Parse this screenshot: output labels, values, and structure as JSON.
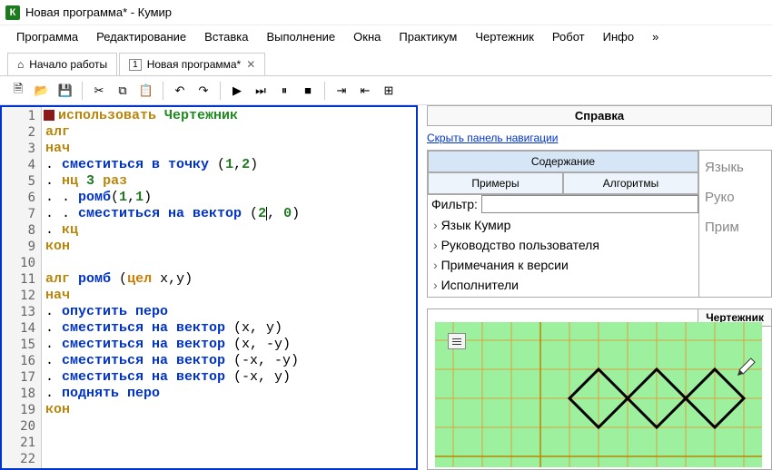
{
  "window": {
    "title": "Новая программа* - Кумир",
    "icon_letter": "К"
  },
  "menubar": [
    "Программа",
    "Редактирование",
    "Вставка",
    "Выполнение",
    "Окна",
    "Практикум",
    "Чертежник",
    "Робот",
    "Инфо",
    "»"
  ],
  "tabs": [
    {
      "label": "Начало работы",
      "closable": false
    },
    {
      "label": "Новая программа*",
      "closable": true,
      "num": "1"
    }
  ],
  "toolbar_icons": [
    "new",
    "open",
    "save",
    "cut",
    "copy",
    "paste",
    "undo",
    "redo",
    "run",
    "step",
    "pause",
    "stop",
    "indent",
    "outdent",
    "ruler"
  ],
  "code": {
    "lines": [
      [
        {
          "t": "marker"
        },
        {
          "t": "kw",
          "v": "использовать "
        },
        {
          "t": "actor",
          "v": "Чертежник"
        }
      ],
      [
        {
          "t": "kw",
          "v": "алг"
        }
      ],
      [
        {
          "t": "kw",
          "v": "нач"
        }
      ],
      [
        {
          "t": "plain",
          "v": ". "
        },
        {
          "t": "cmd",
          "v": "сместиться в точку"
        },
        {
          "t": "plain",
          "v": " ("
        },
        {
          "t": "num",
          "v": "1"
        },
        {
          "t": "plain",
          "v": ","
        },
        {
          "t": "num",
          "v": "2"
        },
        {
          "t": "plain",
          "v": ")"
        }
      ],
      [
        {
          "t": "plain",
          "v": ". "
        },
        {
          "t": "kw",
          "v": "нц"
        },
        {
          "t": "plain",
          "v": " "
        },
        {
          "t": "num",
          "v": "3"
        },
        {
          "t": "plain",
          "v": " "
        },
        {
          "t": "kw",
          "v": "раз"
        }
      ],
      [
        {
          "t": "plain",
          "v": ". . "
        },
        {
          "t": "cmd",
          "v": "ромб"
        },
        {
          "t": "plain",
          "v": "("
        },
        {
          "t": "num",
          "v": "1"
        },
        {
          "t": "plain",
          "v": ","
        },
        {
          "t": "num",
          "v": "1"
        },
        {
          "t": "plain",
          "v": ")"
        }
      ],
      [
        {
          "t": "plain",
          "v": ". . "
        },
        {
          "t": "cmd",
          "v": "сместиться на вектор"
        },
        {
          "t": "plain",
          "v": " ("
        },
        {
          "t": "num",
          "v": "2"
        },
        {
          "t": "caret"
        },
        {
          "t": "plain",
          "v": ", "
        },
        {
          "t": "num",
          "v": "0"
        },
        {
          "t": "plain",
          "v": ")"
        }
      ],
      [
        {
          "t": "plain",
          "v": ". "
        },
        {
          "t": "kw",
          "v": "кц"
        }
      ],
      [
        {
          "t": "kw",
          "v": "кон"
        }
      ],
      [],
      [
        {
          "t": "kw",
          "v": "алг"
        },
        {
          "t": "plain",
          "v": " "
        },
        {
          "t": "cmd",
          "v": "ромб"
        },
        {
          "t": "plain",
          "v": " ("
        },
        {
          "t": "typ",
          "v": "цел"
        },
        {
          "t": "plain",
          "v": " x,y)"
        }
      ],
      [
        {
          "t": "kw",
          "v": "нач"
        }
      ],
      [
        {
          "t": "plain",
          "v": ". "
        },
        {
          "t": "cmd",
          "v": "опустить перо"
        }
      ],
      [
        {
          "t": "plain",
          "v": ". "
        },
        {
          "t": "cmd",
          "v": "сместиться на вектор"
        },
        {
          "t": "plain",
          "v": " (x, y)"
        }
      ],
      [
        {
          "t": "plain",
          "v": ". "
        },
        {
          "t": "cmd",
          "v": "сместиться на вектор"
        },
        {
          "t": "plain",
          "v": " (x, -y)"
        }
      ],
      [
        {
          "t": "plain",
          "v": ". "
        },
        {
          "t": "cmd",
          "v": "сместиться на вектор"
        },
        {
          "t": "plain",
          "v": " (-x, -y)"
        }
      ],
      [
        {
          "t": "plain",
          "v": ". "
        },
        {
          "t": "cmd",
          "v": "сместиться на вектор"
        },
        {
          "t": "plain",
          "v": " (-x, y)"
        }
      ],
      [
        {
          "t": "plain",
          "v": ". "
        },
        {
          "t": "cmd",
          "v": "поднять перо"
        }
      ],
      [
        {
          "t": "kw",
          "v": "кон"
        }
      ],
      [],
      [],
      []
    ],
    "line_count": 22
  },
  "help": {
    "panel_title": "Справка",
    "hide_link": "Скрыть панель навигации",
    "nav_buttons": {
      "contents": "Содержание",
      "examples": "Примеры",
      "algorithms": "Алгоритмы"
    },
    "filter_label": "Фильтр:",
    "filter_value": "",
    "tree": [
      "Язык Кумир",
      "Руководство пользователя",
      "Примечания к версии",
      "Исполнители"
    ],
    "side_items": [
      "Языкь",
      "Руко",
      "Прим"
    ]
  },
  "canvas": {
    "title": "Чертежник"
  }
}
